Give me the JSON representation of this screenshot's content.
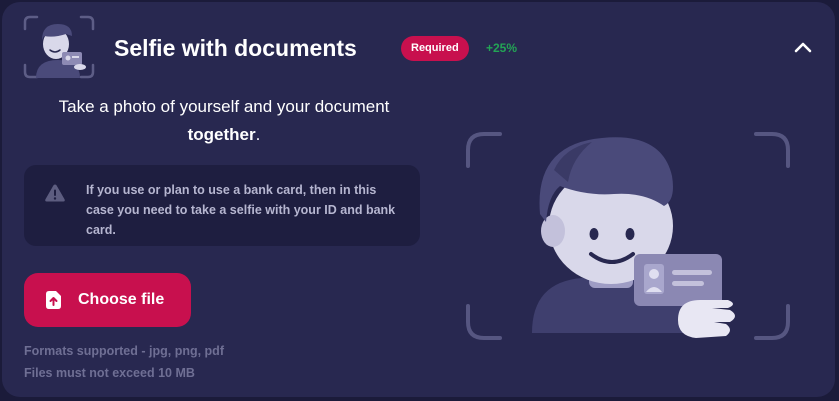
{
  "header": {
    "title": "Selfie with documents",
    "badge": "Required",
    "bonus": "+25%",
    "collapse_icon": "chevron-up-icon",
    "thumbnail_icon": "selfie-with-id-icon"
  },
  "instruction": {
    "text": "Take a photo of yourself and your document",
    "emphasis": "together",
    "suffix": "."
  },
  "warning": {
    "icon": "warning-triangle-icon",
    "text": "If you use or plan to use a bank card, then in this case you need to take a selfie with your ID and bank card."
  },
  "upload": {
    "button_label": "Choose file",
    "button_icon": "upload-file-icon",
    "formats": "Formats supported - jpg, png, pdf",
    "limit": "Files must not exceed 10 MB"
  },
  "colors": {
    "background": "#282850",
    "accent": "#c8104e",
    "success": "#23a455",
    "muted_text": "#6f6f94"
  }
}
